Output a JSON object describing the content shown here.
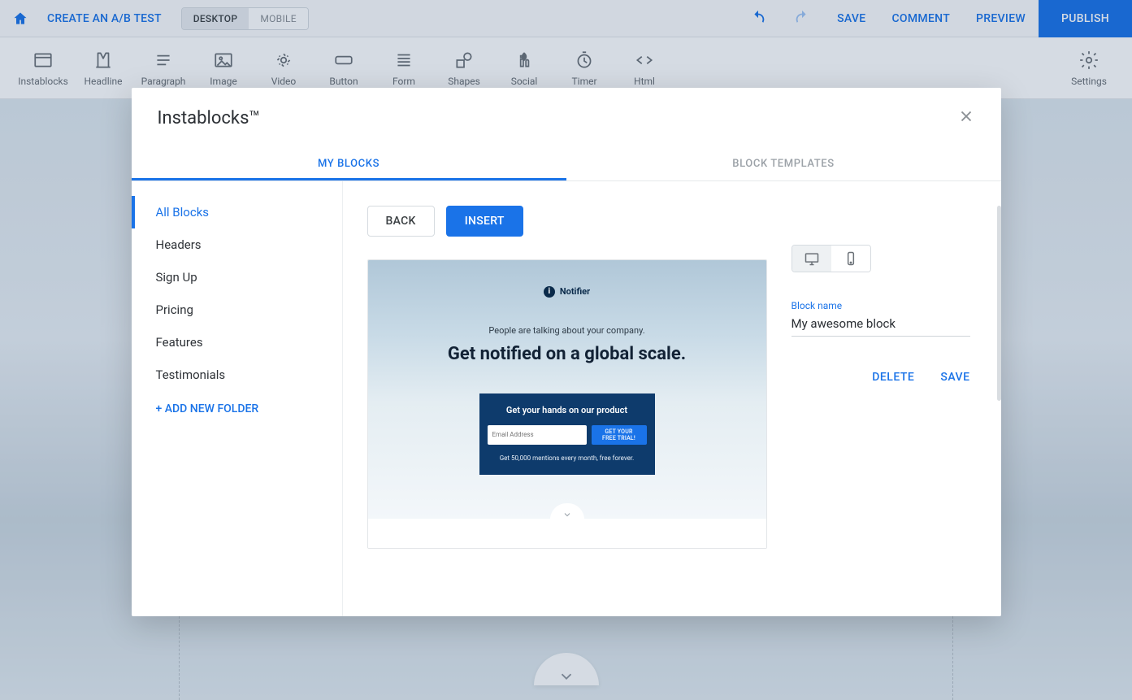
{
  "topbar": {
    "ab_test": "CREATE AN A/B TEST",
    "desktop": "DESKTOP",
    "mobile": "MOBILE",
    "save": "SAVE",
    "comment": "COMMENT",
    "preview": "PREVIEW",
    "publish": "PUBLISH"
  },
  "tools": {
    "instablocks": "Instablocks",
    "headline": "Headline",
    "paragraph": "Paragraph",
    "image": "Image",
    "video": "Video",
    "button": "Button",
    "form": "Form",
    "shapes": "Shapes",
    "social": "Social",
    "timer": "Timer",
    "html": "Html",
    "settings": "Settings"
  },
  "modal": {
    "title": "Instablocks™",
    "tab_my_blocks": "MY BLOCKS",
    "tab_templates": "BLOCK TEMPLATES",
    "side": {
      "all": "All Blocks",
      "headers": "Headers",
      "signup": "Sign Up",
      "pricing": "Pricing",
      "features": "Features",
      "testimonials": "Testimonials",
      "add_folder": "+ ADD NEW FOLDER"
    },
    "back": "BACK",
    "insert": "INSERT",
    "block_name_label": "Block name",
    "block_name_value": "My awesome block",
    "delete": "DELETE",
    "save": "SAVE"
  },
  "preview": {
    "brand": "Notifier",
    "tagline": "People are talking about your company.",
    "headline": "Get notified on a global scale.",
    "cta_title": "Get your hands on our product",
    "email_placeholder": "Email Address",
    "cta_button": "GET YOUR FREE TRIAL!",
    "cta_sub": "Get 50,000 mentions every month, free forever."
  }
}
